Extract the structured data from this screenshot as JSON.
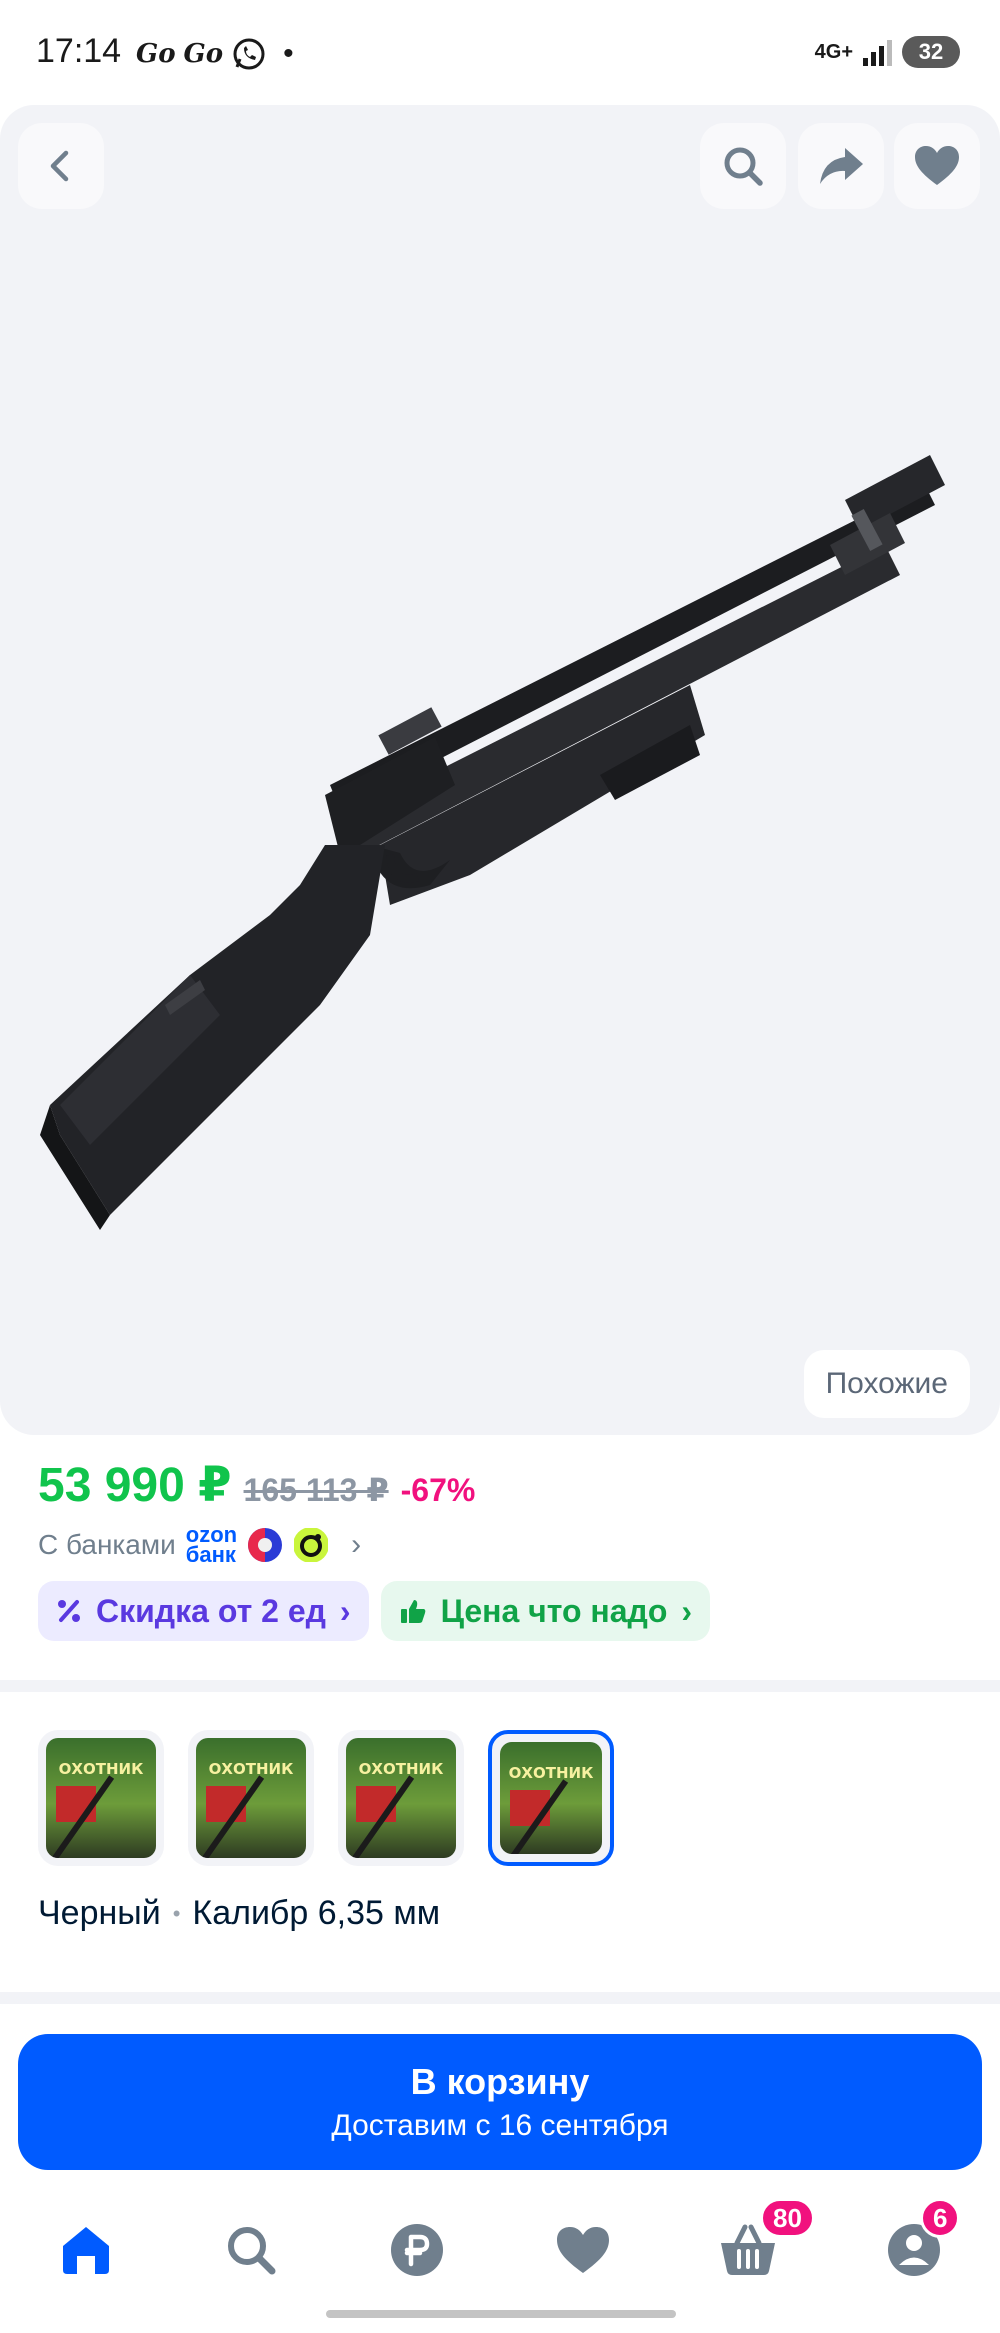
{
  "status_bar": {
    "time": "17:14",
    "apps": [
      "Go",
      "Go"
    ],
    "network": "4G+",
    "battery": "32"
  },
  "hero": {
    "icons": {
      "back": "chevron-left-icon",
      "search": "search-icon",
      "share": "share-arrow-icon",
      "favorite": "heart-icon"
    },
    "similar_label": "Похожие"
  },
  "price": {
    "current": "53 990 ₽",
    "old": "165 113 ₽",
    "discount": "-67%",
    "banks_label": "С банками",
    "ozon_bank_line1": "ozon",
    "ozon_bank_line2": "банк"
  },
  "badges": {
    "discount_label": "Скидка от 2 ед",
    "price_label": "Цена что надо"
  },
  "variants": {
    "thumbnail_title": "ОХОТНИК",
    "color": "Черный",
    "caliber": "Калибр 6,35 мм",
    "selected_index": 3
  },
  "cart": {
    "button_label": "В корзину",
    "delivery": "Доставим с 16 сентября"
  },
  "bottom_nav": {
    "cart_badge": "80",
    "profile_badge": "6"
  },
  "colors": {
    "primary": "#005bff",
    "price_green": "#10c44c",
    "discount_pink": "#f1117e",
    "hero_bg": "#f2f3f7"
  }
}
